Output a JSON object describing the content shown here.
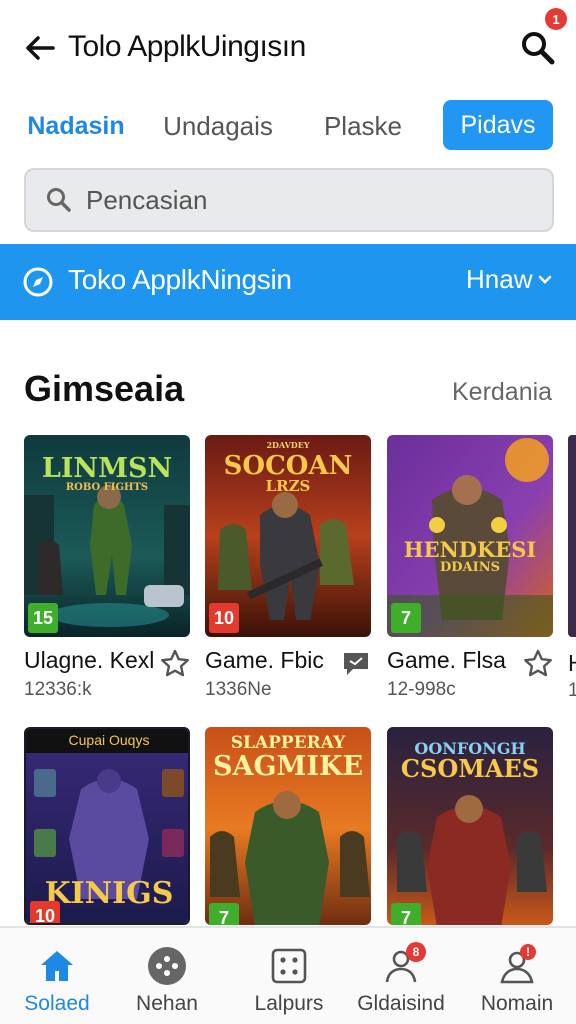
{
  "header": {
    "title": "Tolo ApplkUingısın",
    "search_badge": "1",
    "icons": {
      "back": "back-arrow-icon",
      "search": "search-icon"
    }
  },
  "tabs": [
    {
      "label": "Nadasin",
      "active": true
    },
    {
      "label": "Undagais",
      "active": false
    },
    {
      "label": "Plaske",
      "active": false
    },
    {
      "label": "Pidavs",
      "active": false,
      "highlighted": true
    }
  ],
  "search": {
    "placeholder": "Pencasian",
    "value": ""
  },
  "store_bar": {
    "name": "Toko ApplkNingsin",
    "menu_label": "Hnaw",
    "icon": "compass-icon"
  },
  "section": {
    "title": "Gimseaia",
    "link": "Kerdania"
  },
  "games": [
    {
      "art_title": "LINMSN",
      "art_sub": "ROBO FIGHTS",
      "age": "15",
      "name": "Ulagne. Kexl",
      "meta": "12336:k",
      "action_icon": "star-icon"
    },
    {
      "art_title": "SOCOAN",
      "art_sub": "LRZS",
      "art_top": "2DAVDEY",
      "age": "10",
      "name": "Game. Fbic",
      "meta": "1336Ne",
      "action_icon": "comment-icon"
    },
    {
      "art_title": "HENDKESI",
      "art_sub": "DDAINS",
      "age": "7",
      "name": "Game. Flsa",
      "meta": "12-998c",
      "action_icon": "star-icon"
    },
    {
      "art_title": "KINIGS",
      "art_top": "Cupai Ouqys",
      "age": "10",
      "name": "",
      "meta": ""
    },
    {
      "art_title": "SAGMIKE",
      "art_top": "SLAPPERAY",
      "age": "7",
      "name": "",
      "meta": ""
    },
    {
      "art_title": "CSOMAES",
      "art_top": "OONFONGH",
      "age": "7",
      "name": "",
      "meta": ""
    }
  ],
  "peek": {
    "name": "H",
    "meta": "1"
  },
  "bottom_nav": [
    {
      "label": "Solaed",
      "icon": "home-icon",
      "active": true
    },
    {
      "label": "Nehan",
      "icon": "gamepad-icon",
      "active": false
    },
    {
      "label": "Lalpurs",
      "icon": "dice-icon",
      "active": false
    },
    {
      "label": "Gldaisind",
      "icon": "user-icon",
      "active": false,
      "badge": "8"
    },
    {
      "label": "Nomain",
      "icon": "profile-icon",
      "active": false,
      "badge": "!"
    }
  ],
  "colors": {
    "accent": "#1e96f0",
    "tab_active_text": "#1e88e5",
    "badge_red": "#e53935",
    "age_green": "#3fae2a",
    "age_red": "#e33a2c"
  }
}
